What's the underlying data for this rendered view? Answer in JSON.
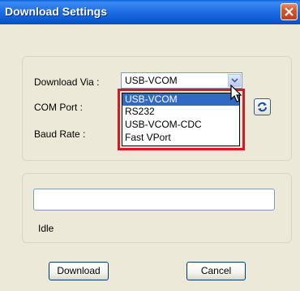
{
  "window": {
    "title": "Download Settings"
  },
  "settings": {
    "download_via_label": "Download Via :",
    "com_port_label": "COM Port :",
    "baud_rate_label": "Baud Rate :",
    "download_via_value": "USB-VCOM",
    "download_via_options": [
      "USB-VCOM",
      "RS232",
      "USB-VCOM-CDC",
      "Fast VPort"
    ],
    "selected_option_index": 0
  },
  "progress": {
    "fraction": 0,
    "status_text": "Idle"
  },
  "buttons": {
    "download": "Download",
    "cancel": "Cancel"
  },
  "colors": {
    "highlight_box": "#e3151a",
    "selection": "#316ac5"
  }
}
